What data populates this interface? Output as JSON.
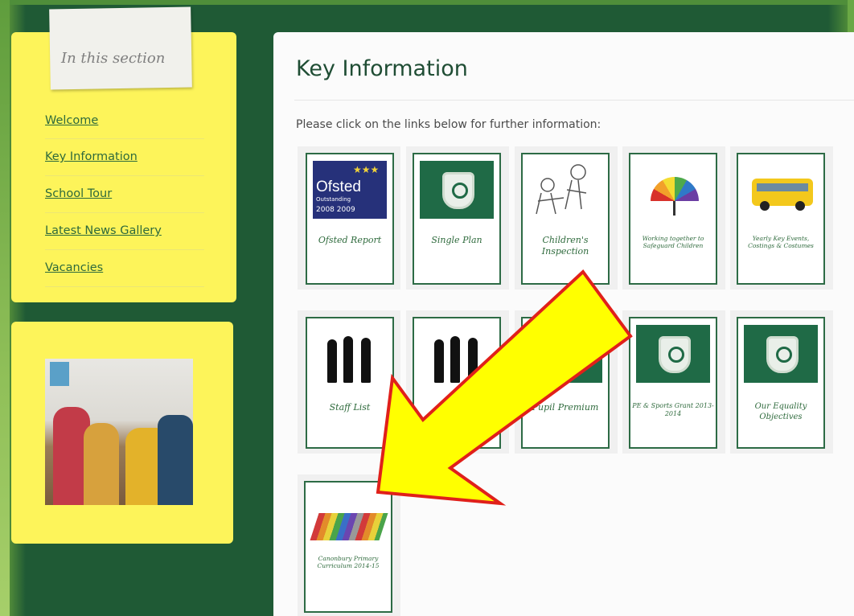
{
  "sidebar": {
    "section_title": "In this section",
    "items": [
      {
        "label": "Welcome"
      },
      {
        "label": "Key Information"
      },
      {
        "label": "School Tour"
      },
      {
        "label": "Latest News Gallery"
      },
      {
        "label": "Vacancies"
      }
    ]
  },
  "main": {
    "title": "Key Information",
    "intro": "Please click on the links below for further information:",
    "tiles": [
      {
        "label": "Ofsted Report",
        "icon": "ofsted-logo",
        "ofsted_lines": [
          "Ofsted",
          "Outstanding",
          "2008 2009"
        ]
      },
      {
        "label": "Single Plan",
        "icon": "school-crest"
      },
      {
        "label": "Children's Inspection",
        "icon": "children-drawing"
      },
      {
        "label": "Working together to Safeguard Children",
        "icon": "umbrella"
      },
      {
        "label": "Yearly Key Events, Costings & Costumes",
        "icon": "school-bus"
      },
      {
        "label": "Staff List",
        "icon": "people-silhouettes"
      },
      {
        "label": "",
        "icon": "people-silhouettes"
      },
      {
        "label": "Pupil Premium",
        "icon": "school-crest"
      },
      {
        "label": "PE & Sports Grant 2013-2014",
        "icon": "school-crest"
      },
      {
        "label": "Our Equality Objectives",
        "icon": "school-crest"
      },
      {
        "label": "Canonbury Primary Curriculum 2014-15",
        "icon": "crayons"
      }
    ]
  },
  "colors": {
    "background_green": "#1f5a35",
    "sidebar_yellow": "#fdf45a",
    "link_green": "#2e6a3c",
    "arrow_fill": "#ffff00",
    "arrow_stroke": "#e0201a"
  }
}
